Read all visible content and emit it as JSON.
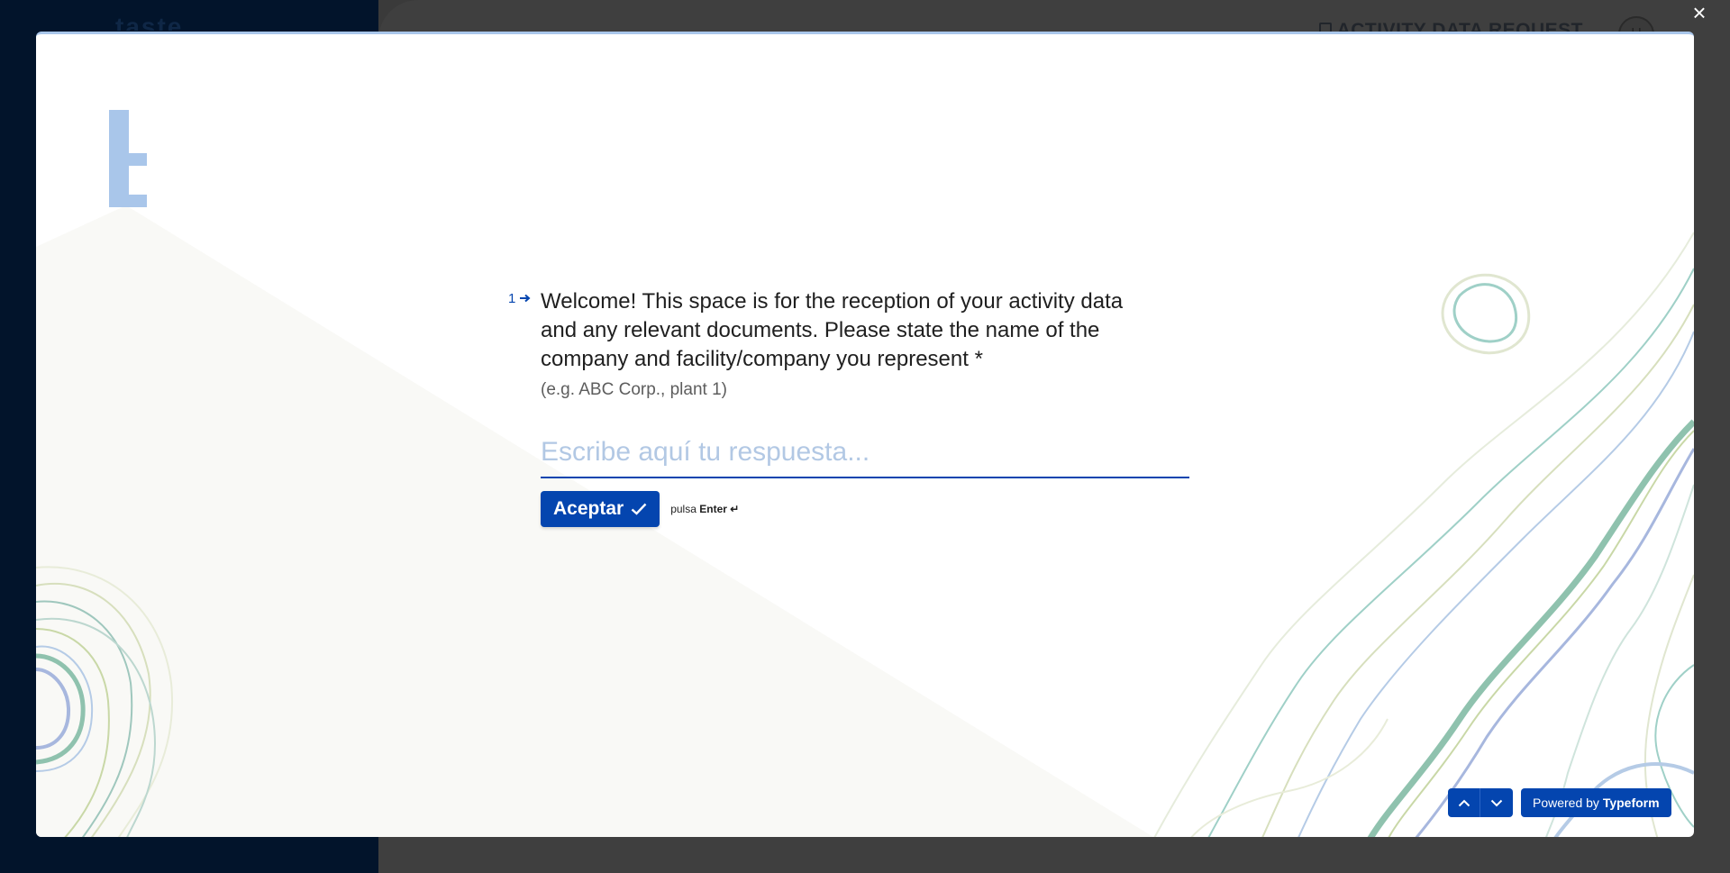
{
  "background": {
    "logo_text": "taste",
    "header_title": "ACTIVITY DATA REQUEST",
    "avatar_initial": "U"
  },
  "modal": {
    "close_symbol": "×",
    "brand_letter": "t"
  },
  "question": {
    "number": "1",
    "text": "Welcome! This space is for the reception of your activity data and any relevant documents. Please state the name of the company and facility/company you represent *",
    "description": "(e.g. ABC Corp., plant 1)",
    "answer_placeholder": "Escribe aquí tu respuesta...",
    "answer_value": ""
  },
  "actions": {
    "accept_label": "Aceptar",
    "hint_prefix": "pulsa",
    "hint_key": "Enter ↵"
  },
  "footer": {
    "powered_prefix": "Powered by",
    "powered_brand": "Typeform"
  },
  "colors": {
    "accent": "#0445af",
    "placeholder": "#b2c8e4",
    "brand_light": "#a9c6ea",
    "page_dark": "#02142b",
    "overlay": "#3f3f3f"
  },
  "icons": [
    "close-icon",
    "arrow-right-icon",
    "checkmark-icon",
    "chevron-up-icon",
    "chevron-down-icon",
    "return-key-icon"
  ]
}
